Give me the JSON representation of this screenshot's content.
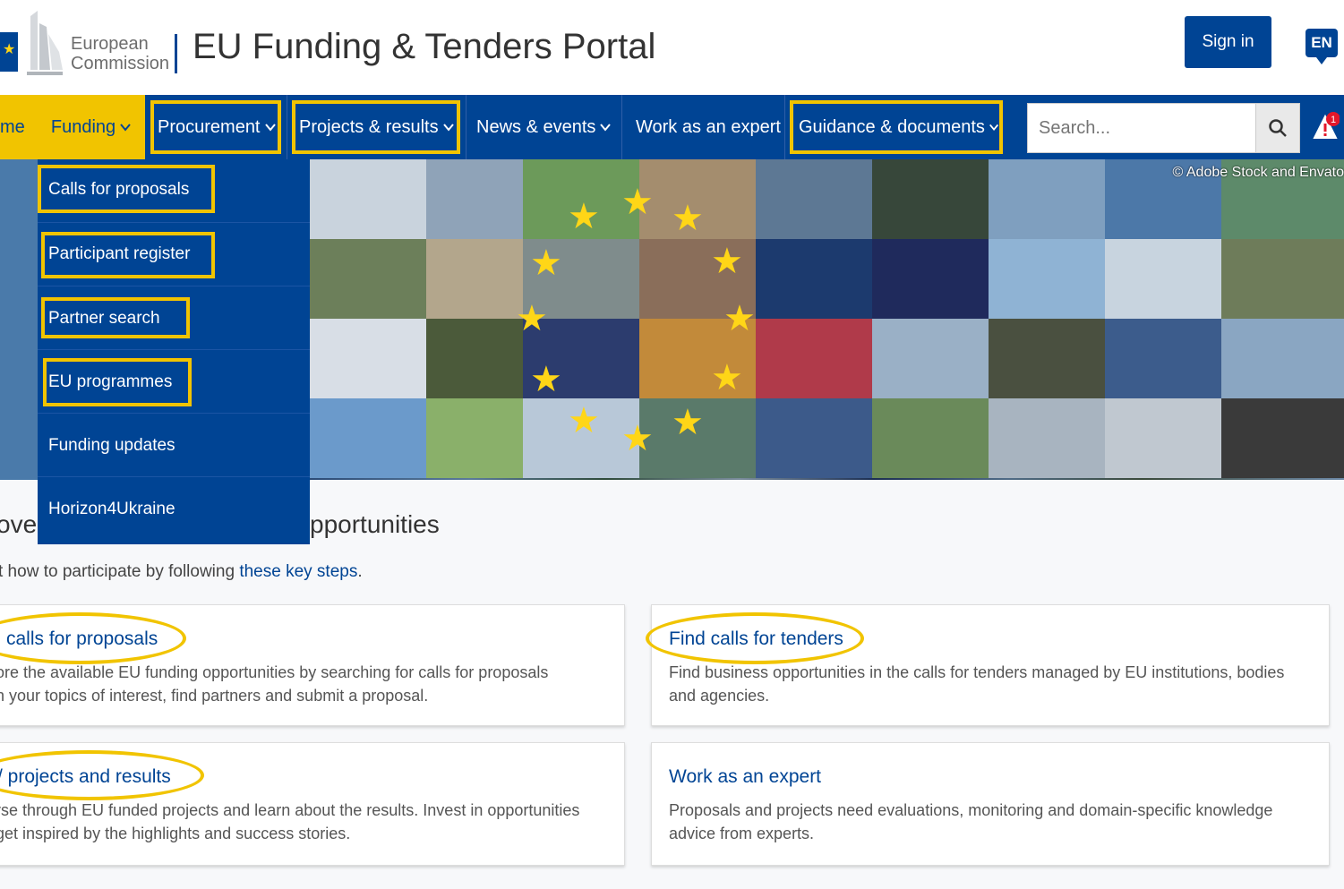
{
  "header": {
    "ec_line1": "European",
    "ec_line2": "Commission",
    "portal_title": "EU Funding & Tenders Portal",
    "sign_in": "Sign in",
    "language": "EN"
  },
  "nav": {
    "home": "me",
    "funding": "Funding",
    "procurement": "Procurement",
    "projects": "Projects & results",
    "news": "News & events",
    "expert": "Work as an expert",
    "guidance": "Guidance & documents",
    "search_placeholder": "Search...",
    "alert_count": "1"
  },
  "hero": {
    "credit": "© Adobe Stock and Envato"
  },
  "dropdown": {
    "items": [
      {
        "label": "Calls for proposals"
      },
      {
        "label": "Participant register"
      },
      {
        "label": "Partner search"
      },
      {
        "label": "EU programmes"
      },
      {
        "label": "Funding updates"
      },
      {
        "label": "Horizon4Ukraine"
      }
    ]
  },
  "main": {
    "heading_left": "ove",
    "heading_right": "pportunities",
    "intro_text": "t how to participate by following ",
    "intro_link": "these key steps",
    "intro_end": ".",
    "cards": [
      {
        "title": "calls for proposals",
        "line1": "ore the available EU funding opportunities by searching for calls for proposals",
        "line2": "n your topics of interest, find partners and submit a proposal."
      },
      {
        "title": "Find calls for tenders",
        "line1": "Find business opportunities in the calls for tenders managed by EU institutions, bodies",
        "line2": "and agencies."
      },
      {
        "title": "/ projects and results",
        "line1": "rse through EU funded projects and learn about the results. Invest in opportunities",
        "line2": "get inspired by the highlights and success stories."
      },
      {
        "title": "Work as an expert",
        "line1": "Proposals and projects need evaluations, monitoring and domain-specific knowledge",
        "line2": "advice from experts."
      }
    ]
  },
  "colors": {
    "brand_blue": "#004494",
    "highlight_yellow": "#f1c400",
    "star_yellow": "#ffd617"
  }
}
